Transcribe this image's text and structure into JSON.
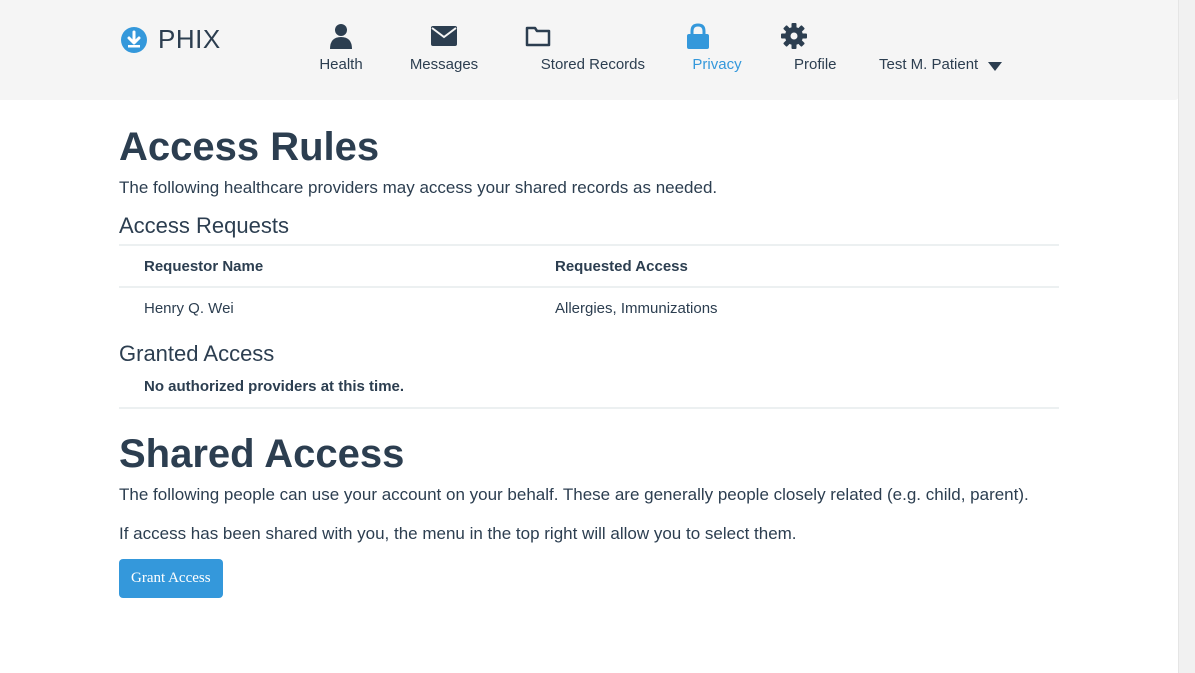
{
  "app": {
    "name": "PHIX"
  },
  "nav": {
    "items": [
      {
        "label": "Health",
        "icon": "user-icon"
      },
      {
        "label": "Messages",
        "icon": "envelope-icon"
      },
      {
        "label": "Stored Records",
        "icon": "folder-icon"
      },
      {
        "label": "Privacy",
        "icon": "lock-icon",
        "active": true
      },
      {
        "label": "Profile",
        "icon": "gear-icon"
      }
    ],
    "user": "Test M. Patient"
  },
  "access_rules": {
    "title": "Access Rules",
    "description": "The following healthcare providers may access your shared records as needed.",
    "requests": {
      "title": "Access Requests",
      "columns": [
        "Requestor Name",
        "Requested Access"
      ],
      "rows": [
        [
          "Henry Q. Wei",
          "Allergies, Immunizations"
        ]
      ]
    },
    "granted": {
      "title": "Granted Access",
      "empty_message": "No authorized providers at this time."
    }
  },
  "shared_access": {
    "title": "Shared Access",
    "description": "The following people can use your account on your behalf. These are generally people closely related (e.g. child, parent).",
    "note": "If access has been shared with you, the menu in the top right will allow you to select them.",
    "button_label": "Grant Access"
  },
  "colors": {
    "accent": "#3498db",
    "text": "#2c3e50",
    "navbar": "#f5f5f5"
  }
}
